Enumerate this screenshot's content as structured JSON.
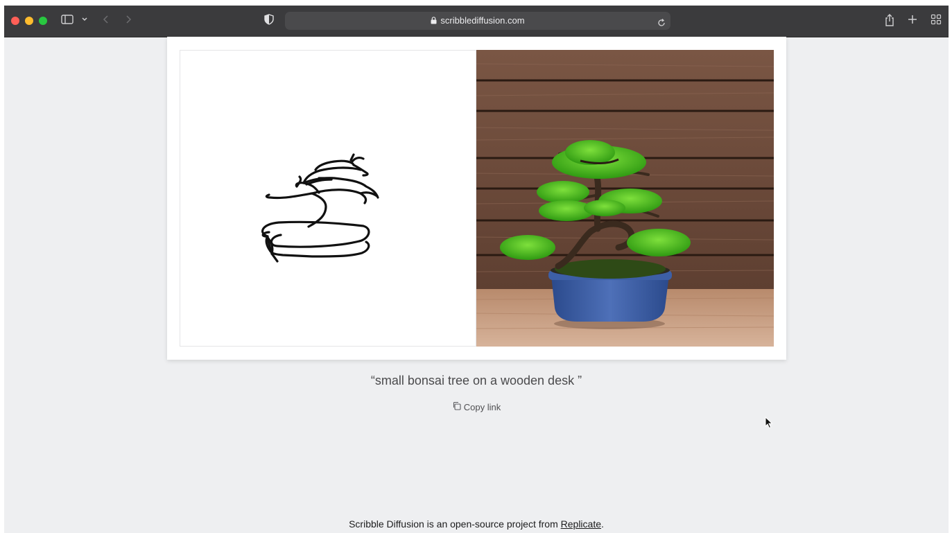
{
  "browser": {
    "url": "scribblediffusion.com",
    "icons": [
      "sidebar-icon",
      "chevron-down-icon",
      "back-icon",
      "forward-icon",
      "shield-icon",
      "lock-icon",
      "reload-icon",
      "share-icon",
      "new-tab-icon",
      "tab-overview-icon"
    ]
  },
  "main": {
    "prompt": "“small bonsai tree on a wooden desk ”",
    "copy_link": "Copy link"
  },
  "footer": {
    "text_before": "Scribble Diffusion is an open-source project from ",
    "link": "Replicate",
    "text_after": "."
  },
  "colors": {
    "page_background": "#eeeff1",
    "toolbar": "#3b3b3d",
    "wood": "#6b4a39",
    "pot": "#3b5a9e",
    "foliage": "#46c21c"
  }
}
